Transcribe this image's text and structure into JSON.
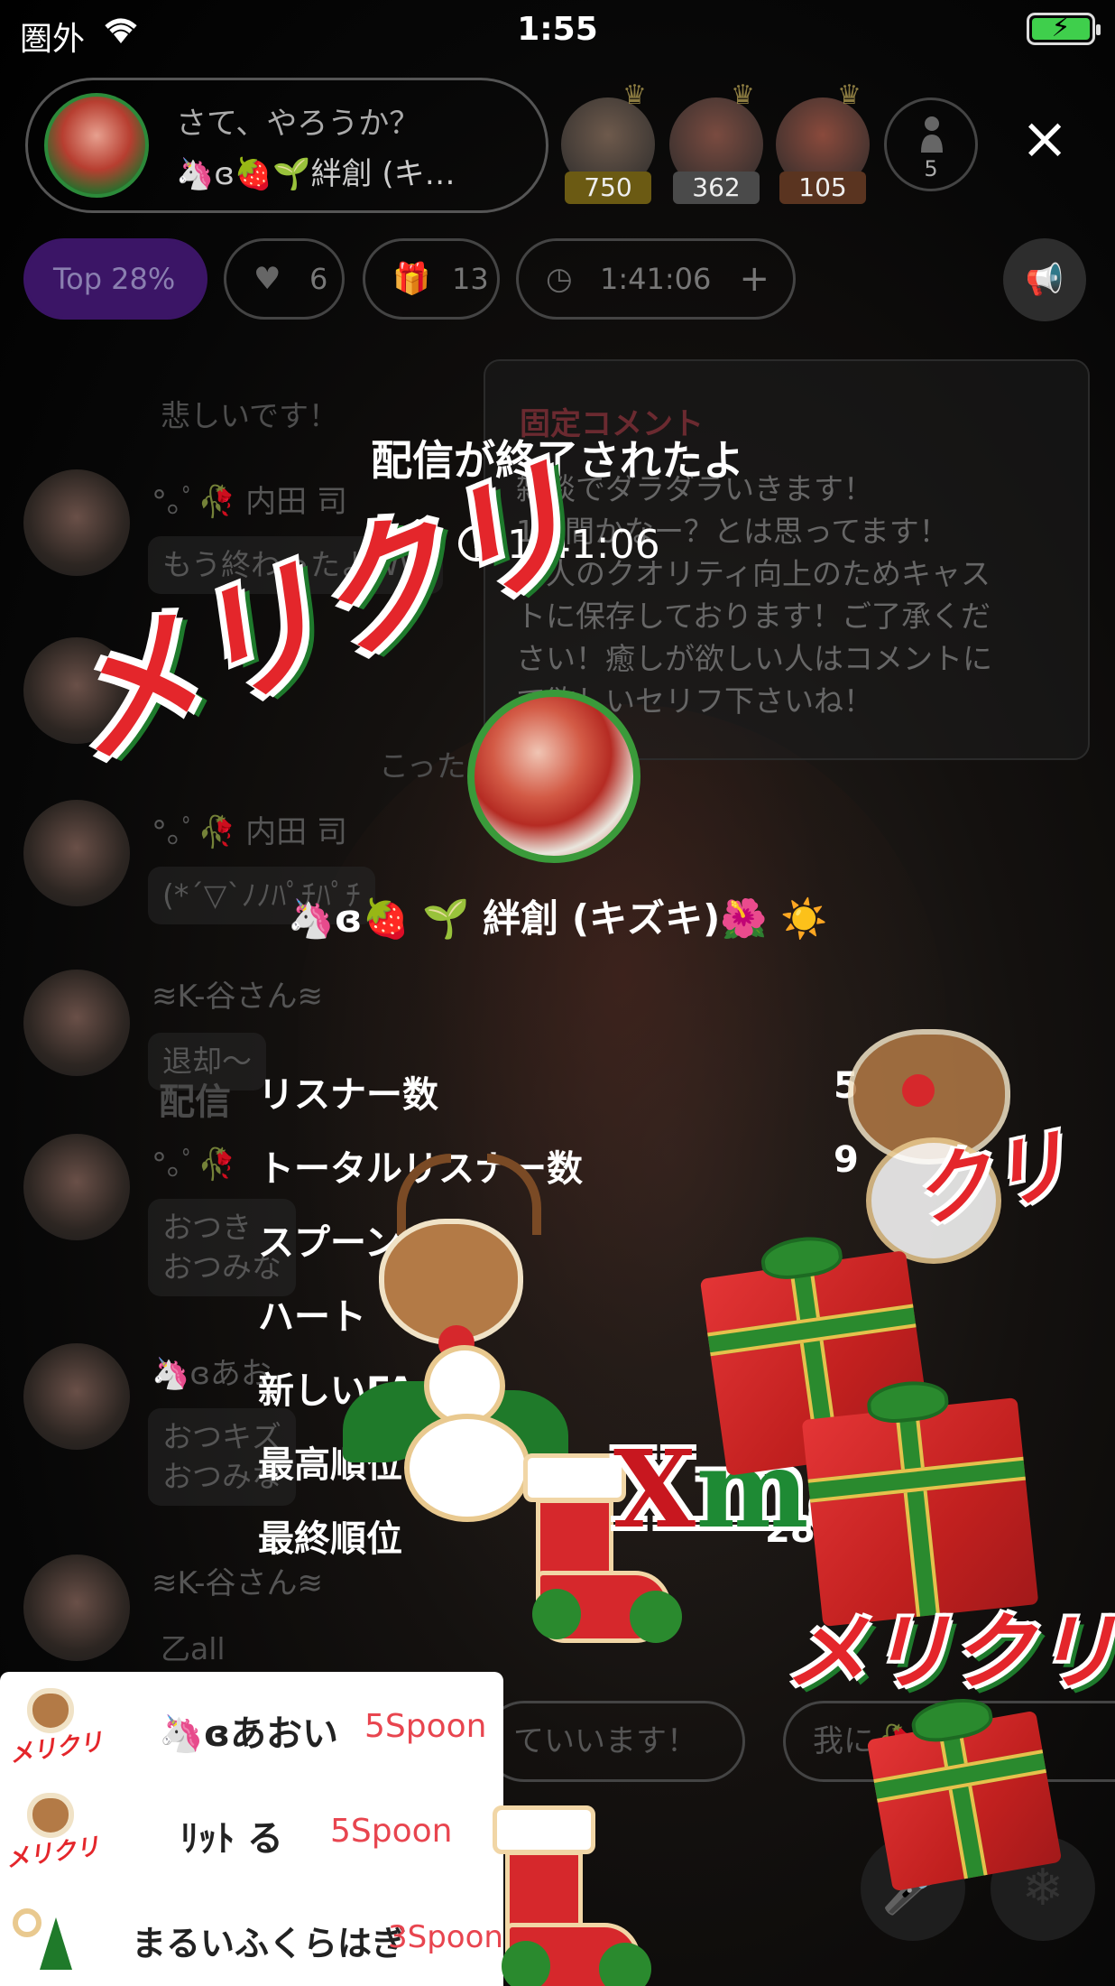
{
  "status_bar": {
    "carrier": "圏外",
    "time": "1:55",
    "battery_color": "#3fcf4c"
  },
  "header": {
    "dj_title": "さて、やろうか？",
    "dj_name": "🦄ɞ🍓🌱絆創 (キ…",
    "top_ranks": [
      {
        "value": "750",
        "badge_color": "#6b5a13"
      },
      {
        "value": "362",
        "badge_color": "#4a4a4a"
      },
      {
        "value": "105",
        "badge_color": "#5a3420"
      }
    ],
    "listener_count": "5",
    "close_icon": "close-icon"
  },
  "stats_bar": {
    "top_label": "Top",
    "top_percent": "28%",
    "hearts": "6",
    "gifts": "13",
    "elapsed": "1:41:06",
    "accent_color": "#3b1566"
  },
  "pinned_comment": {
    "title": "固定コメント",
    "lines": [
      "雑談でダラダラいきます！",
      "1時間かなー？とは思ってます！",
      "本人のクオリティ向上のためキャス",
      "トに保存しております！ご了承くだ",
      "さい！癒しが欲しい人はコメントに",
      "て欲しいセリフ下さいね！"
    ]
  },
  "chat": {
    "top_partial": "悲しいです！",
    "messages": [
      {
        "name": "°｡ﾟ🥀 内田 司",
        "text": "もう終わったよWW"
      },
      {
        "name": "",
        "text": "こった"
      },
      {
        "name": "°｡ﾟ🥀 内田 司",
        "text": "(*´▽`ﾉﾉﾊﾟﾁﾊﾟﾁ"
      },
      {
        "name": "≋K-谷さん≋",
        "text": "退却〜",
        "tier": "7"
      },
      {
        "name": "°｡ﾟ🥀",
        "text": "おつき",
        "text2": "おつみな"
      },
      {
        "name": "🦄ɞあお",
        "text": "おつキズ",
        "text2": "おつみな",
        "tier": "3"
      },
      {
        "name": "≋K-谷さん≋",
        "text": "乙all",
        "tier": "7"
      }
    ],
    "faded_label": "配信"
  },
  "ended_modal": {
    "title": "配信が終了されたよ",
    "duration": "1:41:06",
    "host_name": "🦄ɞ🍓 🌱 絆創 (キズキ)🌺 ☀️",
    "stats": [
      {
        "label": "リスナー数",
        "value": "5"
      },
      {
        "label": "トータルリスナー数",
        "value": "9"
      },
      {
        "label": "スプーン",
        "value": ""
      },
      {
        "label": "ハート",
        "value": ""
      },
      {
        "label": "新しいFA",
        "value": ""
      },
      {
        "label": "最高順位",
        "value": ""
      },
      {
        "label": "最終順位",
        "value": "28"
      }
    ]
  },
  "bottom": {
    "pill1_text": "ていいます！",
    "pill2_text": "我に🥀 するの",
    "mic_icon": "mic-icon",
    "snowflake_icon": "snowflake-icon"
  },
  "gift_notifications": [
    {
      "sender": "🦄ɞあおい",
      "amount": "5Spoon",
      "sticker": "メリクリ"
    },
    {
      "sender": "ﾘｯﾄ る",
      "amount": "5Spoon",
      "sticker": "メリクリ"
    },
    {
      "sender": "まるいふくらはぎ",
      "amount": "3Spoon",
      "sticker": ""
    }
  ],
  "overlay": {
    "merry_big": "メリクリ",
    "merry_small": "メリクリ",
    "merry_partial": "クリ",
    "xmas_x": "X",
    "xmas_ma": "ma"
  }
}
